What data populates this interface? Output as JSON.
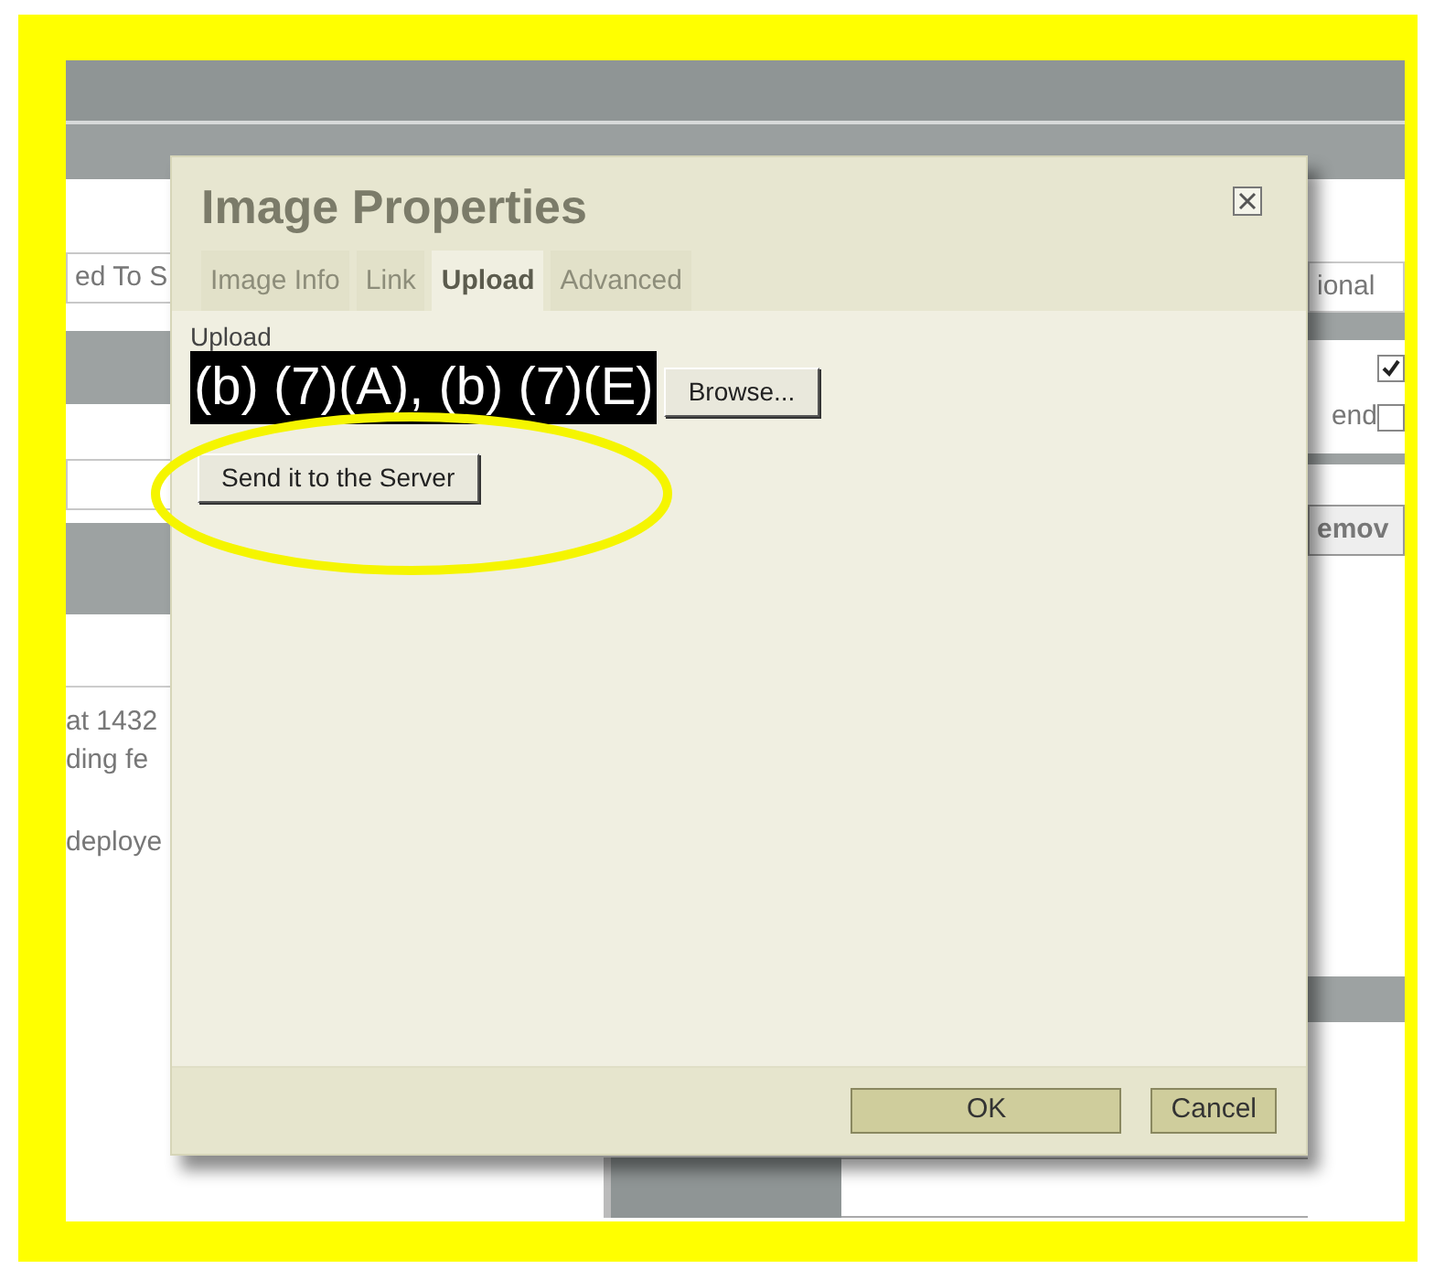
{
  "background": {
    "left_field": "ed To S",
    "left_lines": [
      "at 1432",
      "ding fe",
      "deploye"
    ],
    "right_field": "ional",
    "right_checks": [
      {
        "checked": true
      },
      {
        "label": "end",
        "checked": false
      }
    ],
    "right_button": "emov"
  },
  "dialog": {
    "title": "Image Properties",
    "tabs": [
      {
        "label": "Image Info",
        "selected": false
      },
      {
        "label": "Link",
        "selected": false
      },
      {
        "label": "Upload",
        "selected": true
      },
      {
        "label": "Advanced",
        "selected": false
      }
    ],
    "upload_label": "Upload",
    "redaction": "(b) (7)(A), (b) (7)(E)",
    "browse_button": "Browse...",
    "send_button": "Send it to the Server",
    "buttons": [
      "OK",
      "Cancel"
    ]
  }
}
